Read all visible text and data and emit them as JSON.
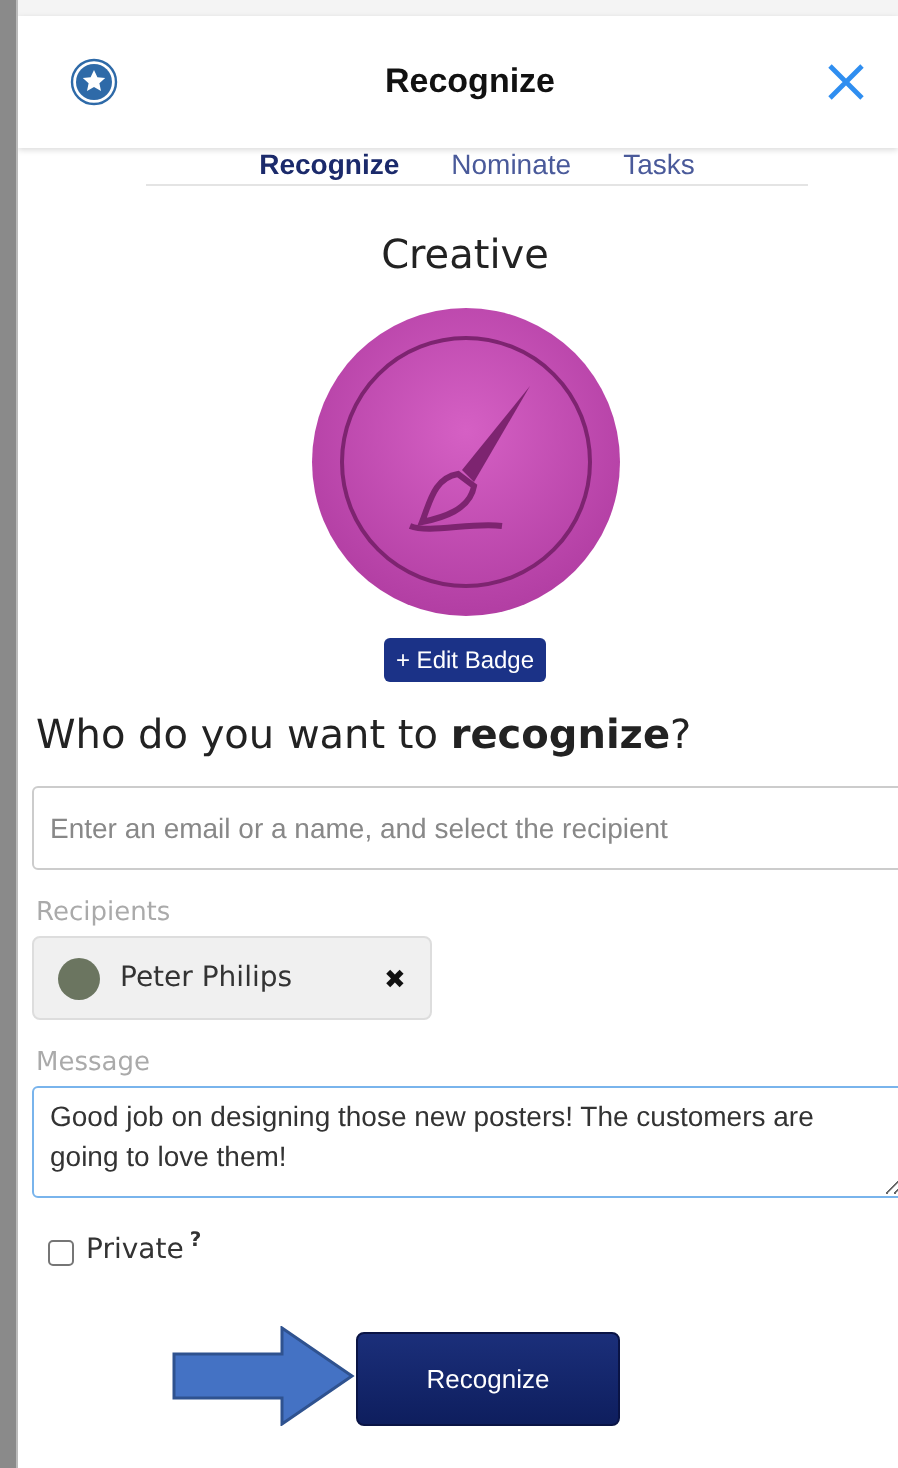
{
  "header": {
    "title": "Recognize"
  },
  "tabs": [
    {
      "label": "Recognize",
      "selected": true
    },
    {
      "label": "Nominate",
      "selected": false
    },
    {
      "label": "Tasks",
      "selected": false
    }
  ],
  "badge": {
    "name": "Creative",
    "edit_button": "+ Edit Badge"
  },
  "question": "Who do you want to **recognize**?",
  "recipient_search": {
    "placeholder": "Enter an email or a name, and select the recipient"
  },
  "recipients": {
    "label": "Recipients",
    "items": [
      {
        "name": "Peter Philips",
        "remove": "✖"
      }
    ]
  },
  "message": {
    "label": "Message",
    "value": "Good job on designing those new posters! The customers are going to love them!"
  },
  "private": {
    "label": "Private",
    "hint": "?",
    "checked": false
  },
  "submit": "Recognize"
}
